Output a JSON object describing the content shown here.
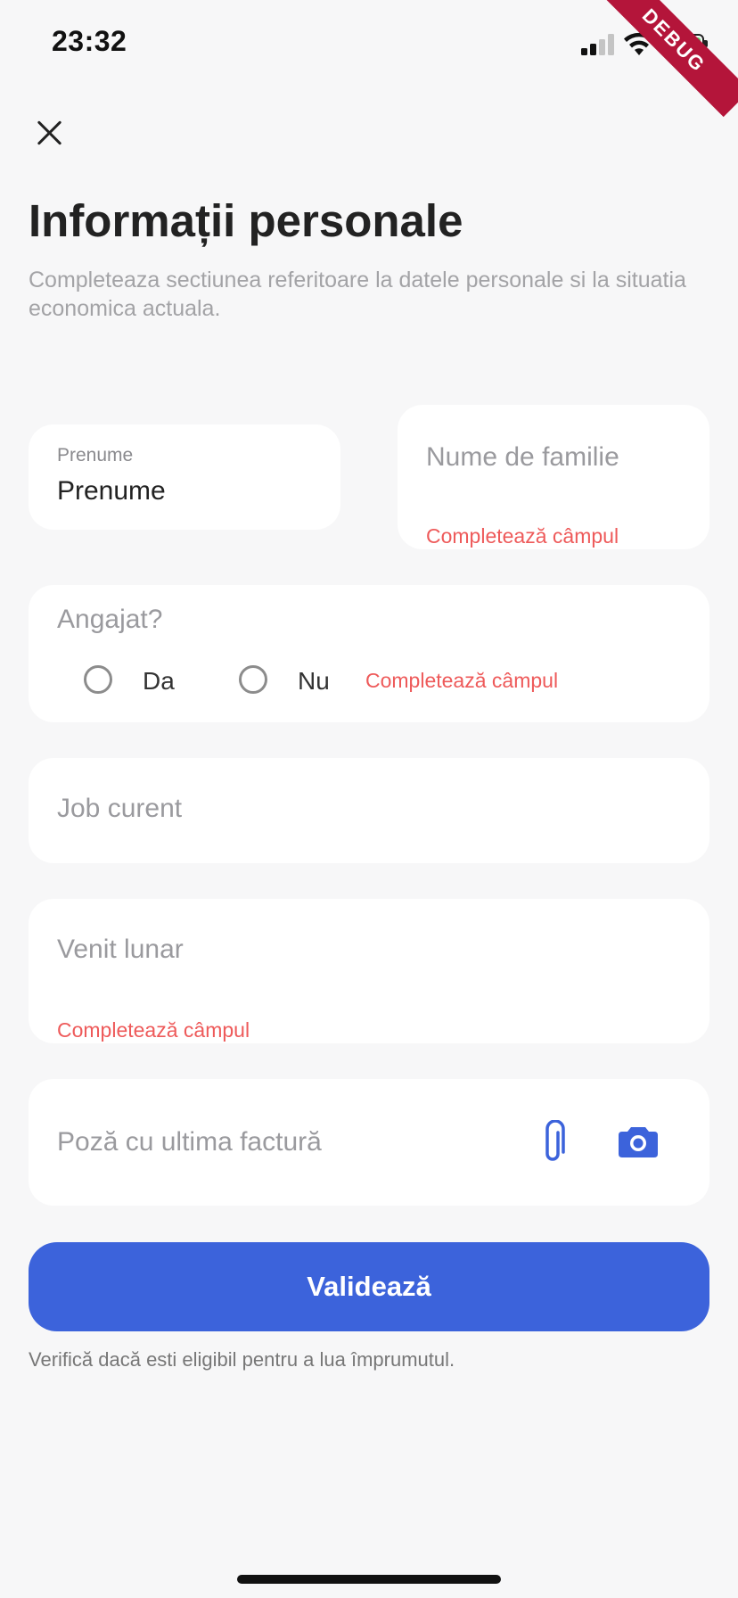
{
  "status_bar": {
    "time": "23:32",
    "debug_banner": "DEBUG"
  },
  "header": {
    "close_icon": "close-icon",
    "title": "Informații personale",
    "subtitle": "Completeaza sectiunea referitoare la datele personale si la situatia economica actuala."
  },
  "form": {
    "first_name": {
      "label": "Prenume",
      "value": "Prenume"
    },
    "last_name": {
      "placeholder": "Nume de familie",
      "error": "Completează câmpul"
    },
    "employed": {
      "label": "Angajat?",
      "options": [
        "Da",
        "Nu"
      ],
      "error": "Completează câmpul"
    },
    "job": {
      "placeholder": "Job curent"
    },
    "income": {
      "placeholder": "Venit lunar",
      "error": "Completează câmpul"
    },
    "bill_photo": {
      "placeholder": "Poză cu ultima factură",
      "attach_icon": "paperclip-icon",
      "camera_icon": "camera-icon"
    }
  },
  "submit": {
    "label": "Validează",
    "hint": "Verifică dacă esti eligibil pentru a lua împrumutul."
  },
  "colors": {
    "accent": "#3c63db",
    "error": "#ee5a5a",
    "background": "#f7f7f8"
  }
}
